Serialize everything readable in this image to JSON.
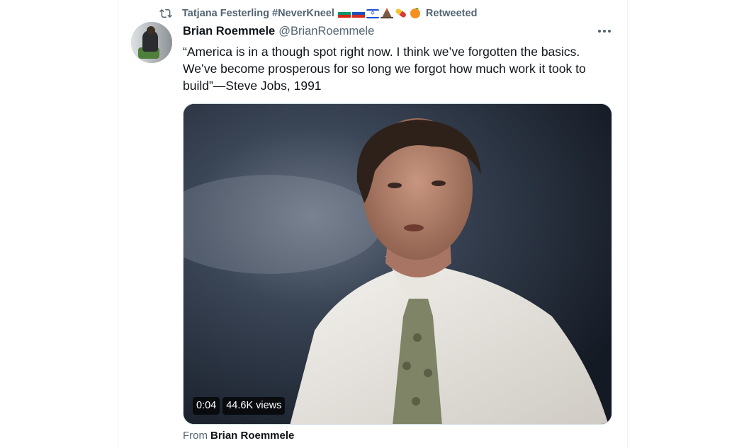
{
  "retweet": {
    "user": "Tatjana Festerling #NeverKneel",
    "suffix": "Retweeted",
    "emojis": [
      "flag-bulgaria",
      "flag-russia",
      "flag-israel",
      "volcano",
      "pill",
      "orange"
    ]
  },
  "tweet": {
    "display_name": "Brian Roemmele",
    "handle": "@BrianRoemmele",
    "text_lines": [
      "“America is in a though spot right now. I think we’ve forgotten the basics.",
      "We’ve become prosperous for so long we forgot how much work it took to",
      "build”—Steve Jobs, 1991"
    ]
  },
  "video": {
    "time": "0:04",
    "views": "44.6K views"
  },
  "source": {
    "prefix": "From",
    "name": "Brian Roemmele"
  },
  "icons": {
    "retweet": "retweet-icon",
    "more": "more-icon"
  },
  "colors": {
    "text_primary": "#0f1419",
    "text_secondary": "#536471",
    "border": "#eff3f4"
  }
}
